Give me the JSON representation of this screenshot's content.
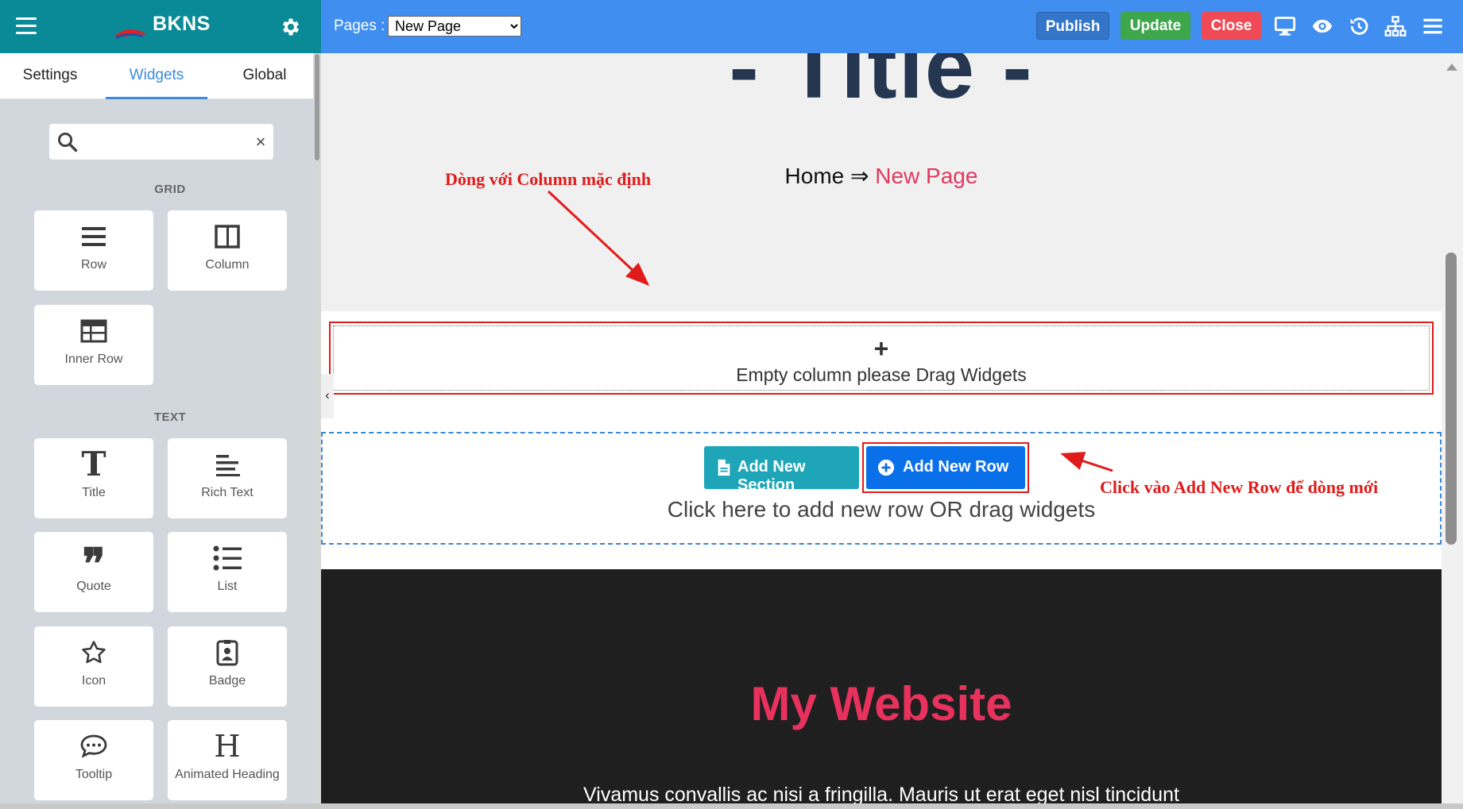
{
  "sidebar": {
    "brand": "BKNS",
    "tabs": [
      {
        "label": "Settings"
      },
      {
        "label": "Widgets"
      },
      {
        "label": "Global"
      }
    ],
    "search": {
      "value": "",
      "placeholder": "",
      "clear": "×"
    },
    "sections": {
      "grid": "GRID",
      "text": "TEXT"
    },
    "widgets": {
      "row": "Row",
      "column": "Column",
      "inner_row": "Inner Row",
      "title": "Title",
      "rich_text": "Rich Text",
      "quote": "Quote",
      "list": "List",
      "icon": "Icon",
      "badge": "Badge",
      "tooltip": "Tooltip",
      "animated_heading": "Animated Heading"
    },
    "icon_glyphs": {
      "title": "T",
      "quote": "❞",
      "animated_heading": "H"
    }
  },
  "topbar": {
    "pages_label": "Pages :",
    "selected_page": "New Page",
    "publish": "Publish",
    "update": "Update",
    "close": "Close"
  },
  "canvas": {
    "hero_title": "- Title -",
    "breadcrumb_home": "Home",
    "breadcrumb_sep": "⇒",
    "breadcrumb_current": "New Page",
    "plus": "+",
    "empty_column_text": "Empty column please Drag Widgets",
    "collapse": "‹",
    "add_new_section": "Add New Section",
    "add_new_row": "Add New Row",
    "add_hint": "Click here to add new row OR drag widgets",
    "site_title": "My Website",
    "site_text": "Vivamus convallis ac nisi a fringilla. Mauris ut erat eget nisl tincidunt"
  },
  "annotations": {
    "default_column": "Dòng với Column mặc định",
    "add_row_hint": "Click vào Add New Row để dòng mới"
  },
  "colors": {
    "sidebar_header": "#0a8a97",
    "topbar": "#3f8ef0",
    "publish": "#3375c8",
    "update": "#3ea64b",
    "close": "#ef4a55",
    "accent": "#e2375f",
    "annotation": "#e01b1b",
    "add_section": "#1ea6b8",
    "add_row": "#0a70ea"
  },
  "icons": [
    "menu-icon",
    "gear-icon",
    "search-icon",
    "row-icon",
    "column-icon",
    "inner-row-icon",
    "title-icon",
    "rich-text-icon",
    "quote-icon",
    "list-icon",
    "star-icon",
    "badge-icon",
    "tooltip-icon",
    "animated-heading-icon",
    "desktop-icon",
    "eye-icon",
    "history-icon",
    "sitemap-icon",
    "file-icon",
    "plus-circle-icon"
  ]
}
